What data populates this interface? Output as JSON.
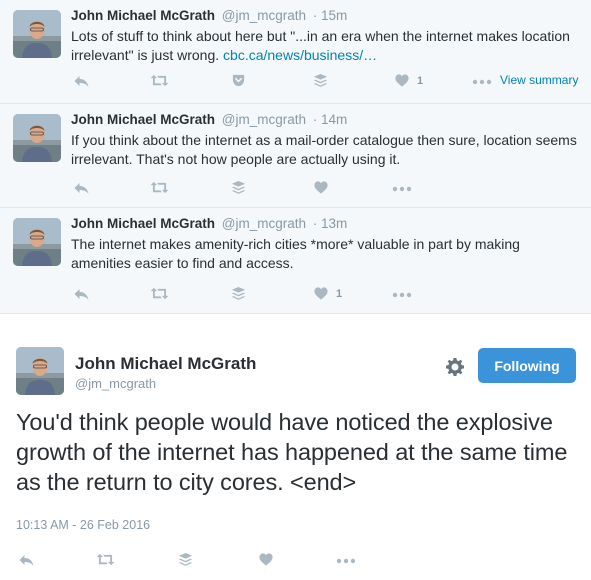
{
  "tweets": [
    {
      "name": "John Michael McGrath",
      "handle": "@jm_mcgrath",
      "time": "· 15m",
      "text_before": "Lots of stuff to think about here but \"...in an era when the internet makes location irrelevant\" is just wrong. ",
      "link": "cbc.ca/news/business/…",
      "like_count": "1",
      "view_summary": "View summary"
    },
    {
      "name": "John Michael McGrath",
      "handle": "@jm_mcgrath",
      "time": "· 14m",
      "text_before": "If you think about the internet as a mail-order catalogue then sure, location seems irrelevant. That's not how people are actually using it.",
      "link": "",
      "like_count": "",
      "view_summary": ""
    },
    {
      "name": "John Michael McGrath",
      "handle": "@jm_mcgrath",
      "time": "· 13m",
      "text_before": "The internet makes amenity-rich cities *more* valuable in part by making amenities easier to find and access.",
      "link": "",
      "like_count": "1",
      "view_summary": ""
    }
  ],
  "main": {
    "name": "John Michael McGrath",
    "handle": "@jm_mcgrath",
    "follow_label": "Following",
    "text": "You'd think people would have noticed the explosive growth of the internet has happened at the same time as the return to city cores. <end>",
    "timestamp": "10:13 AM - 26 Feb 2016"
  },
  "icons": {
    "reply": "reply-icon",
    "retweet": "retweet-icon",
    "pocket": "pocket-icon",
    "buffer": "buffer-icon",
    "like": "heart-icon",
    "more": "more-icon",
    "gear": "gear-icon"
  },
  "colors": {
    "link": "#0084b4",
    "follow_bg": "#3b94d9",
    "icon": "#aab8c2",
    "tweet_bg": "#f5f8fa"
  }
}
